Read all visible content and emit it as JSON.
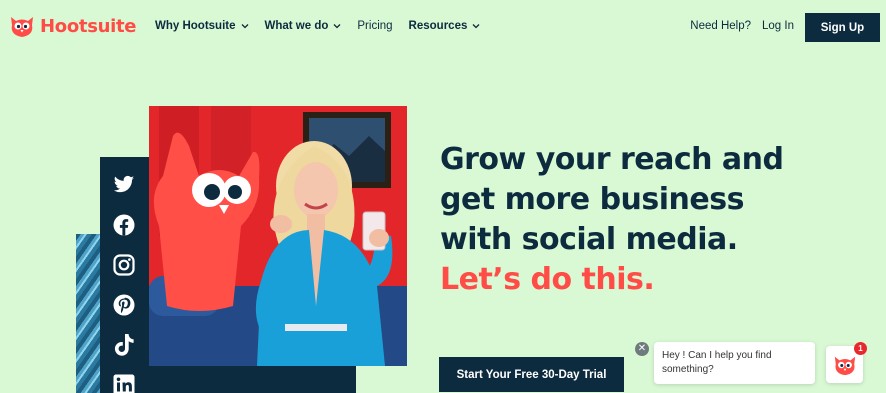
{
  "brand": {
    "name": "Hootsuite",
    "color": "#ff4c46",
    "logo_icon": "owl-logo-icon"
  },
  "nav": {
    "items": [
      {
        "label": "Why Hootsuite",
        "has_dropdown": true
      },
      {
        "label": "What we do",
        "has_dropdown": true
      },
      {
        "label": "Pricing",
        "has_dropdown": false
      },
      {
        "label": "Resources",
        "has_dropdown": true
      }
    ],
    "need_help": "Need Help?",
    "login": "Log In",
    "signup": "Sign Up"
  },
  "hero": {
    "headline": "Grow your reach and get more business with social media.",
    "tagline": "Let’s do this.",
    "cta": "Start Your Free 30-Day Trial",
    "social_icons": [
      "twitter-icon",
      "facebook-icon",
      "instagram-icon",
      "pinterest-icon",
      "tiktok-icon",
      "linkedin-icon"
    ]
  },
  "chat": {
    "message": "Hey ! Can I help you find something?",
    "badge_count": "1",
    "close_icon": "close-icon"
  },
  "colors": {
    "background": "#d9f8d4",
    "navy": "#0d2b3e",
    "accent": "#ff4c46"
  }
}
